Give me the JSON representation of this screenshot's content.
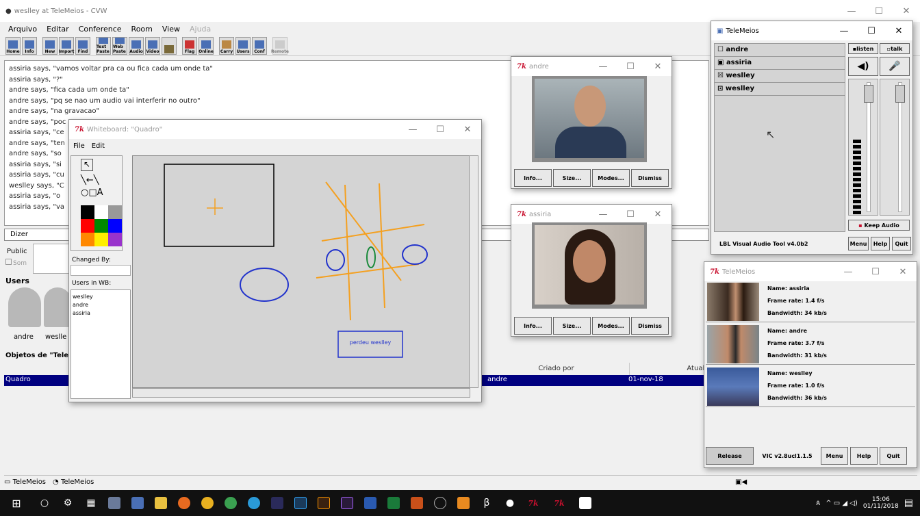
{
  "main": {
    "title": "weslley at TeleMeios - CVW",
    "menu": [
      "Arquivo",
      "Editar",
      "Conference",
      "Room",
      "View"
    ],
    "menu_disabled": "Ajuda",
    "toolbar": [
      "Home",
      "Info",
      "New",
      "Import",
      "Find",
      "Text Paste",
      "Web Paste",
      "Audio",
      "Video",
      "",
      "Flag",
      "Online",
      "Carry",
      "Users",
      "Conf",
      "Remote"
    ],
    "chat": [
      "assiria says, \"vamos voltar pra ca ou fica cada um onde ta\"",
      "assiria says, \"?\"",
      "andre says, \"fica cada um onde ta\"",
      "andre says, \"pq se nao um audio vai interferir no outro\"",
      "andre says, \"na gravacao\"",
      "andre says, \"poc",
      "assiria says, \"ce",
      "andre says, \"ten",
      "andre says, \"so",
      "assiria says, \"si",
      "assiria says, \"cu",
      "weslley says, \"C",
      "assiria says, \"o",
      "assiria says, \"va"
    ],
    "say_label": "Dizer",
    "public_label": "Public",
    "some_label": "Som",
    "users_heading": "Users",
    "users": [
      "andre",
      "weslle"
    ],
    "objects_heading": "Objetos de \"Tele",
    "table_headers": [
      "Criado por",
      "Atuali"
    ],
    "table_row": {
      "name": "Quadro",
      "creator": "andre",
      "updated": "01-nov-18"
    },
    "status_items": [
      "TeleMeios",
      "TeleMeios"
    ]
  },
  "whiteboard": {
    "title": "Whiteboard: \"Quadro\"",
    "menu": [
      "File",
      "Edit"
    ],
    "changed_by_label": "Changed By:",
    "users_label": "Users in WB:",
    "users": [
      "weslley",
      "andre",
      "assiria"
    ],
    "palette": [
      "#000000",
      "#ffffff",
      "#999999",
      "#ff0000",
      "#008000",
      "#0000ff",
      "#ff8800",
      "#ffee00",
      "#9933cc"
    ],
    "text_box": "perdeu weslley"
  },
  "video_andre": {
    "title": "andre",
    "buttons": [
      "Info...",
      "Size...",
      "Modes...",
      "Dismiss"
    ]
  },
  "video_assiria": {
    "title": "assiria",
    "buttons": [
      "Info...",
      "Size...",
      "Modes...",
      "Dismiss"
    ]
  },
  "audio": {
    "title": "TeleMeios",
    "users": [
      "andre",
      "assiria",
      "weslley",
      "weslley"
    ],
    "listen": "listen",
    "talk": "talk",
    "keep_audio": "Keep Audio",
    "footer": "LBL Visual Audio Tool v4.0b2",
    "buttons": [
      "Menu",
      "Help",
      "Quit"
    ]
  },
  "vic": {
    "title": "TeleMeios",
    "participants": [
      {
        "name": "Name:  assiria",
        "frame": "Frame rate:   1.4 f/s",
        "bw": "Bandwidth:    34 kb/s"
      },
      {
        "name": "Name:  andre",
        "frame": "Frame rate:   3.7 f/s",
        "bw": "Bandwidth:    31 kb/s"
      },
      {
        "name": "Name:  weslley",
        "frame": "Frame rate:   1.0 f/s",
        "bw": "Bandwidth:    36 kb/s"
      }
    ],
    "release": "Release",
    "version": "VIC v2.8ucl1.1.5",
    "buttons": [
      "Menu",
      "Help",
      "Quit"
    ]
  },
  "taskbar": {
    "time": "15:06",
    "date": "01/11/2018"
  },
  "colors": {
    "selection": "#000080",
    "taskbar": "#111111",
    "accent": "#c8102e"
  }
}
